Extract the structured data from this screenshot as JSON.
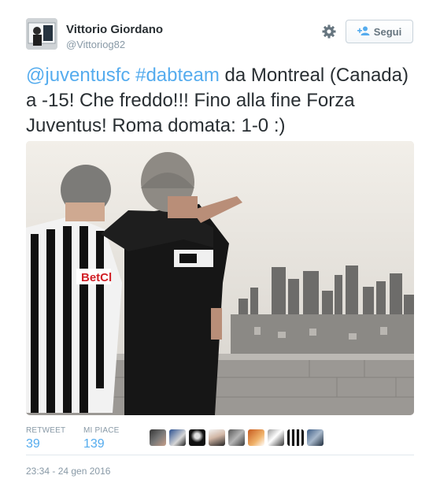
{
  "user": {
    "name": "Vittorio Giordano",
    "handle": "@Vittoriog82"
  },
  "header": {
    "follow_label": "Segui",
    "settings_icon": "gear-icon",
    "follow_icon": "add-user-icon"
  },
  "tweet": {
    "mention": "@juventusfc",
    "hashtag": "#dabteam",
    "text_after": " da Montreal (Canada) a -15! Che freddo!!! Fino alla fine Forza Juventus! Roma domata: 1-0 :)"
  },
  "photo": {
    "jersey_sponsor": "BetCl"
  },
  "stats": {
    "retweet_label": "RETWEET",
    "retweet_count": "39",
    "like_label": "MI PIACE",
    "like_count": "139"
  },
  "timestamp": "23:34 - 24 gen 2016",
  "colors": {
    "link": "#55acee",
    "text": "#292f33",
    "muted": "#8899a6"
  }
}
